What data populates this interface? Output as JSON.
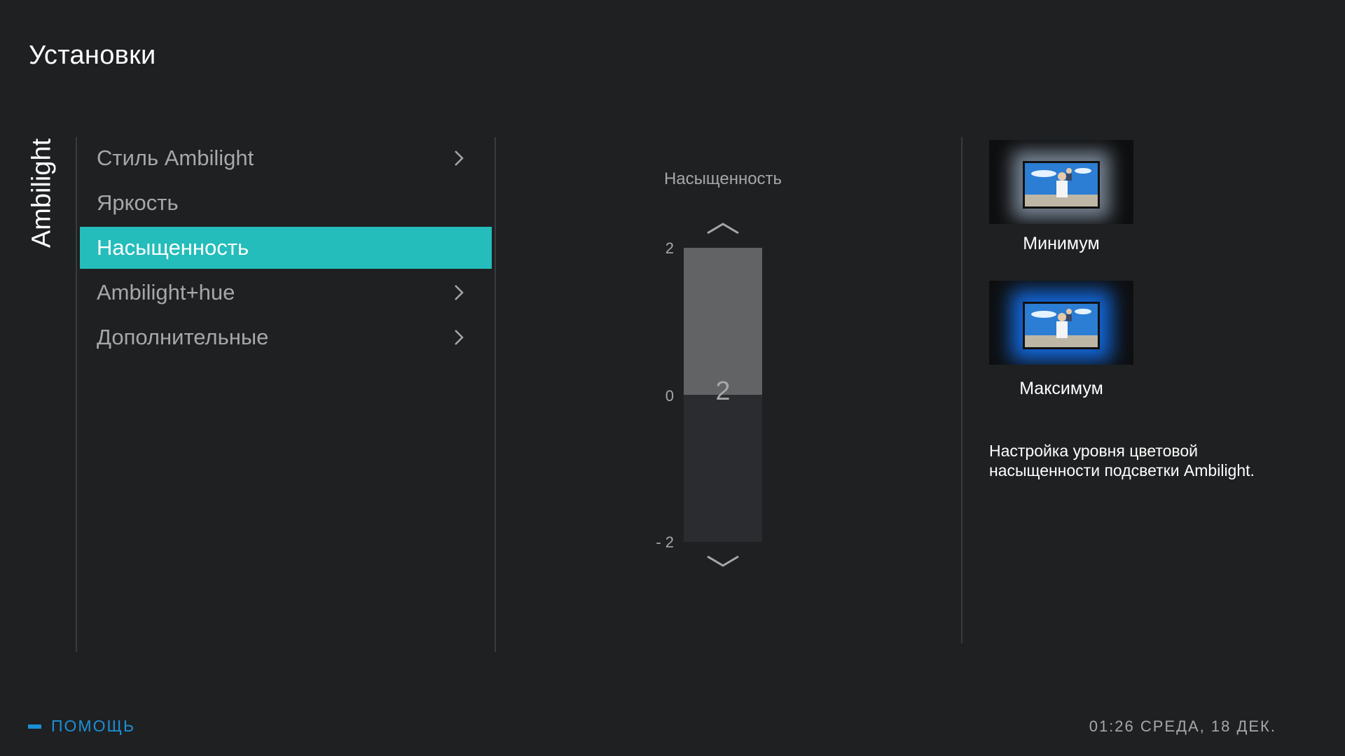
{
  "header": {
    "title": "Установки"
  },
  "sidebar": {
    "tab_label": "Ambilight"
  },
  "menu": {
    "items": [
      {
        "label": "Стиль Ambilight",
        "has_submenu": true,
        "selected": false
      },
      {
        "label": "Яркость",
        "has_submenu": false,
        "selected": false
      },
      {
        "label": "Насыщенность",
        "has_submenu": false,
        "selected": true
      },
      {
        "label": "Ambilight+hue",
        "has_submenu": true,
        "selected": false
      },
      {
        "label": "Дополнительные",
        "has_submenu": true,
        "selected": false
      }
    ]
  },
  "slider": {
    "label": "Насыщенность",
    "value": "2",
    "value_num": 2,
    "tick_max": "2",
    "tick_mid": "0",
    "tick_min": "- 2",
    "range": [
      -2,
      2
    ]
  },
  "options": {
    "min_label": "Минимум",
    "max_label": "Максимум"
  },
  "description": "Настройка уровня цветовой насыщенности подсветки Ambilight.",
  "footer": {
    "help_label": "ПОМОЩЬ",
    "clock": "01:26 СРЕДА, 18 ДЕК."
  },
  "colors": {
    "background": "#1f2022",
    "accent": "#24bdbb",
    "help": "#1c8fd6",
    "text_dim": "#a6a7a9"
  },
  "icons": {
    "submenu": "chevron-right-icon",
    "slider_up": "chevron-up-icon",
    "slider_down": "chevron-down-icon"
  }
}
